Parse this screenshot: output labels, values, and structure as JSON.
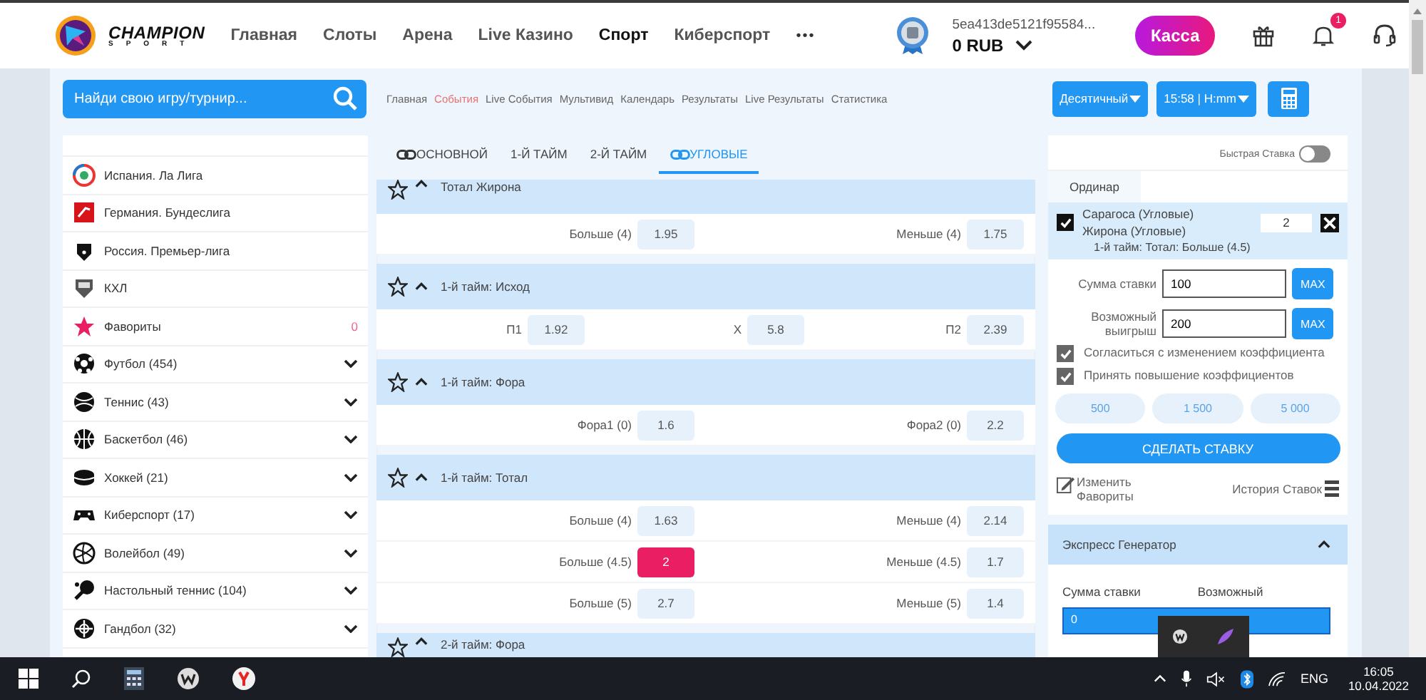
{
  "header": {
    "logo": {
      "name": "CHAMPION",
      "tagline": "SPORT"
    },
    "nav": [
      {
        "label": "Главная",
        "selected": false
      },
      {
        "label": "Слоты",
        "selected": false
      },
      {
        "label": "Арена",
        "selected": false
      },
      {
        "label": "Live Казино",
        "selected": false
      },
      {
        "label": "Спорт",
        "selected": true
      },
      {
        "label": "Киберспорт",
        "selected": false
      }
    ],
    "more": "•••",
    "account": {
      "id": "5ea413de5121f95584...",
      "balance": "0 RUB"
    },
    "cashier": "Касса",
    "notification_count": "1"
  },
  "toolbar": {
    "search": {
      "placeholder": "Найди свою игру/турнир..."
    },
    "breadcrumbs": [
      {
        "label": "Главная",
        "selected": false
      },
      {
        "label": "События",
        "selected": true
      },
      {
        "label": "Live События",
        "selected": false
      },
      {
        "label": "Мультивид",
        "selected": false
      },
      {
        "label": "Календарь",
        "selected": false
      },
      {
        "label": "Результаты",
        "selected": false
      },
      {
        "label": "Live Результаты",
        "selected": false
      },
      {
        "label": "Статистика",
        "selected": false
      }
    ],
    "odds_format": "Десятичный",
    "time_format": "15:58 | H:mm"
  },
  "sidebar": {
    "items": [
      {
        "kind": "league",
        "label": "Испания. Ла Лига"
      },
      {
        "kind": "league",
        "label": "Германия. Бундеслига"
      },
      {
        "kind": "league",
        "label": "Россия. Премьер-лига"
      },
      {
        "kind": "league",
        "label": "КХЛ"
      },
      {
        "kind": "favorites",
        "label": "Фавориты",
        "count": "0"
      },
      {
        "kind": "sport",
        "label": "Футбол (454)",
        "expanded": false
      },
      {
        "kind": "sport",
        "label": "Теннис (43)",
        "expanded": false
      },
      {
        "kind": "sport",
        "label": "Баскетбол (46)",
        "expanded": false
      },
      {
        "kind": "sport",
        "label": "Хоккей (21)",
        "expanded": false
      },
      {
        "kind": "sport",
        "label": "Киберспорт (17)",
        "expanded": false
      },
      {
        "kind": "sport",
        "label": "Волейбол (49)",
        "expanded": false
      },
      {
        "kind": "sport",
        "label": "Настольный теннис (104)",
        "expanded": false
      },
      {
        "kind": "sport",
        "label": "Гандбол (32)",
        "expanded": false
      }
    ]
  },
  "main": {
    "tabs": [
      {
        "label": "ОСНОВНОЙ",
        "linked": true,
        "selected": false
      },
      {
        "label": "1-Й ТАЙМ",
        "linked": false,
        "selected": false
      },
      {
        "label": "2-Й ТАЙМ",
        "linked": false,
        "selected": false
      },
      {
        "label": "УГЛОВЫЕ",
        "linked": true,
        "selected": true
      }
    ],
    "markets": [
      {
        "title": "Тотал Жирона",
        "expanded": true,
        "favorite": false,
        "rows": [
          [
            {
              "label": "Больше (4)",
              "odds": "1.95",
              "selected": false
            },
            {
              "label": "Меньше (4)",
              "odds": "1.75",
              "selected": false
            }
          ]
        ]
      },
      {
        "title": "1-й тайм: Исход",
        "expanded": true,
        "favorite": false,
        "rows": [
          [
            {
              "label": "П1",
              "odds": "1.92",
              "selected": false
            },
            {
              "label": "X",
              "odds": "5.8",
              "selected": false
            },
            {
              "label": "П2",
              "odds": "2.39",
              "selected": false
            }
          ]
        ]
      },
      {
        "title": "1-й тайм: Фора",
        "expanded": true,
        "favorite": false,
        "rows": [
          [
            {
              "label": "Фора1 (0)",
              "odds": "1.6",
              "selected": false
            },
            {
              "label": "Фора2 (0)",
              "odds": "2.2",
              "selected": false
            }
          ]
        ]
      },
      {
        "title": "1-й тайм: Тотал",
        "expanded": true,
        "favorite": false,
        "rows": [
          [
            {
              "label": "Больше (4)",
              "odds": "1.63",
              "selected": false
            },
            {
              "label": "Меньше (4)",
              "odds": "2.14",
              "selected": false
            }
          ],
          [
            {
              "label": "Больше (4.5)",
              "odds": "2",
              "selected": true
            },
            {
              "label": "Меньше (4.5)",
              "odds": "1.7",
              "selected": false
            }
          ],
          [
            {
              "label": "Больше (5)",
              "odds": "2.7",
              "selected": false
            },
            {
              "label": "Меньше (5)",
              "odds": "1.4",
              "selected": false
            }
          ]
        ]
      },
      {
        "title": "2-й тайм: Фора",
        "expanded": true,
        "favorite": false
      }
    ]
  },
  "betslip": {
    "quick_bet": {
      "label": "Быстрая Ставка",
      "on": false
    },
    "tabs": [
      {
        "label": "Ординар",
        "selected": true
      }
    ],
    "selection": {
      "checked": true,
      "home": "Сарагоса (Угловые)",
      "away": "Жирона (Угловые)",
      "market": "1-й тайм: Тотал: Больше (4.5)",
      "odds": "2"
    },
    "stake": {
      "label": "Сумма ставки",
      "value": "100",
      "max": "MAX"
    },
    "win": {
      "label": "Возможный выигрыш",
      "value": "200",
      "max": "MAX"
    },
    "options": [
      {
        "label": "Согласиться с изменением коэффициента",
        "checked": true
      },
      {
        "label": "Принять повышение коэффициентов",
        "checked": true
      }
    ],
    "quick_amounts": [
      "500",
      "1 500",
      "5 000"
    ],
    "submit": "СДЕЛАТЬ СТАВКУ",
    "edit_favorites": "Изменить Фавориты",
    "history": "История Ставок"
  },
  "express": {
    "title": "Экспресс Генератор",
    "expanded": true,
    "stake_label": "Сумма ставки",
    "win_label": "Возможный",
    "stake_value": "0"
  },
  "taskbar": {
    "language": "ENG",
    "time": "16:05",
    "date": "10.04.2022"
  }
}
